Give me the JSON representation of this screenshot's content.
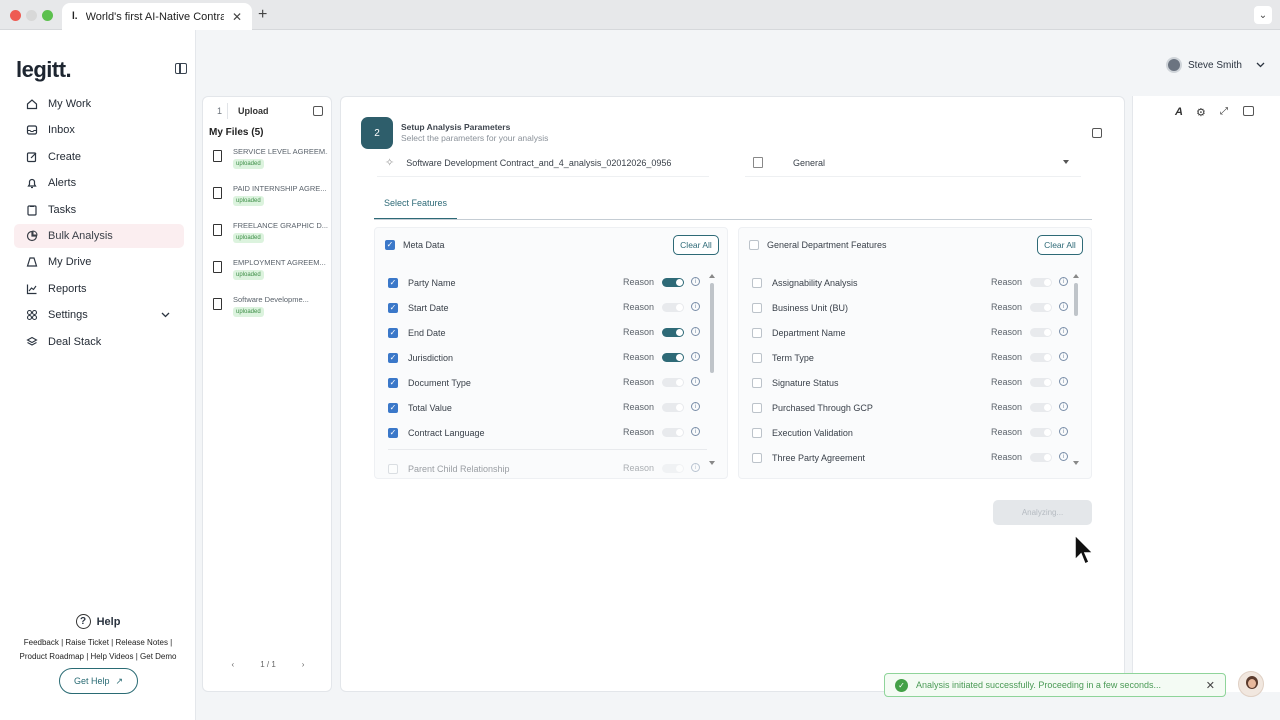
{
  "browser": {
    "tab_favicon": "l.",
    "tab_title": "World's first AI-Native Contra",
    "tab_close": "✕",
    "new_tab": "+",
    "menu": "⌄"
  },
  "sidebar": {
    "logo": "legitt.",
    "items": [
      {
        "label": "My Work",
        "icon": "home-icon"
      },
      {
        "label": "Inbox",
        "icon": "inbox-icon"
      },
      {
        "label": "Create",
        "icon": "edit-icon"
      },
      {
        "label": "Alerts",
        "icon": "bell-icon"
      },
      {
        "label": "Tasks",
        "icon": "clipboard-icon"
      },
      {
        "label": "Bulk Analysis",
        "icon": "chart-icon"
      },
      {
        "label": "My Drive",
        "icon": "drive-icon"
      },
      {
        "label": "Reports",
        "icon": "report-icon"
      },
      {
        "label": "Settings",
        "icon": "settings-icon"
      },
      {
        "label": "Deal Stack",
        "icon": "layers-icon"
      }
    ],
    "help": {
      "title": "Help",
      "links_line1": "Feedback | Raise Ticket | Release Notes |",
      "links_line2": "Product Roadmap | Help Videos | Get Demo",
      "button": "Get Help"
    }
  },
  "header": {
    "user_name": "Steve Smith"
  },
  "upload": {
    "step": "1",
    "label": "Upload",
    "files_title": "My Files (5)",
    "files": [
      {
        "name": "SERVICE LEVEL AGREEM...",
        "status": "uploaded"
      },
      {
        "name": "PAID INTERNSHIP AGRE...",
        "status": "uploaded"
      },
      {
        "name": "FREELANCE GRAPHIC D...",
        "status": "uploaded"
      },
      {
        "name": "EMPLOYMENT AGREEM...",
        "status": "uploaded"
      },
      {
        "name": "Software Developme...",
        "status": "uploaded"
      }
    ],
    "pager": {
      "prev": "‹",
      "page": "1 / 1",
      "next": "›"
    }
  },
  "setup": {
    "step": "2",
    "title": "Setup Analysis Parameters",
    "subtitle": "Select the parameters for your analysis",
    "analysis_name": "Software Development Contract_and_4_analysis_02012026_0956",
    "department": "General",
    "tab": "Select Features",
    "left_box": {
      "title": "Meta Data",
      "clear": "Clear All",
      "rows": [
        {
          "label": "Party Name",
          "checked": true,
          "reason_on": true
        },
        {
          "label": "Start Date",
          "checked": true,
          "reason_on": false
        },
        {
          "label": "End Date",
          "checked": true,
          "reason_on": true
        },
        {
          "label": "Jurisdiction",
          "checked": true,
          "reason_on": true
        },
        {
          "label": "Document Type",
          "checked": true,
          "reason_on": false
        },
        {
          "label": "Total Value",
          "checked": true,
          "reason_on": false
        },
        {
          "label": "Contract Language",
          "checked": true,
          "reason_on": false
        }
      ],
      "partial_row": "Parent Child Relationship"
    },
    "right_box": {
      "title": "General Department Features",
      "clear": "Clear All",
      "rows": [
        {
          "label": "Assignability Analysis"
        },
        {
          "label": "Business Unit (BU)"
        },
        {
          "label": "Department Name"
        },
        {
          "label": "Term Type"
        },
        {
          "label": "Signature Status"
        },
        {
          "label": "Purchased Through GCP"
        },
        {
          "label": "Execution Validation"
        },
        {
          "label": "Three Party Agreement"
        }
      ]
    },
    "reason_label": "Reason",
    "analyze_button": "Analyzing..."
  },
  "toast": {
    "message": "Analysis initiated successfully. Proceeding in a few seconds...",
    "close": "✕"
  },
  "colors": {
    "accent": "#2e6a77",
    "active_nav_bg": "#fbeef0",
    "success": "#43a047",
    "checkbox": "#3b78c9"
  }
}
